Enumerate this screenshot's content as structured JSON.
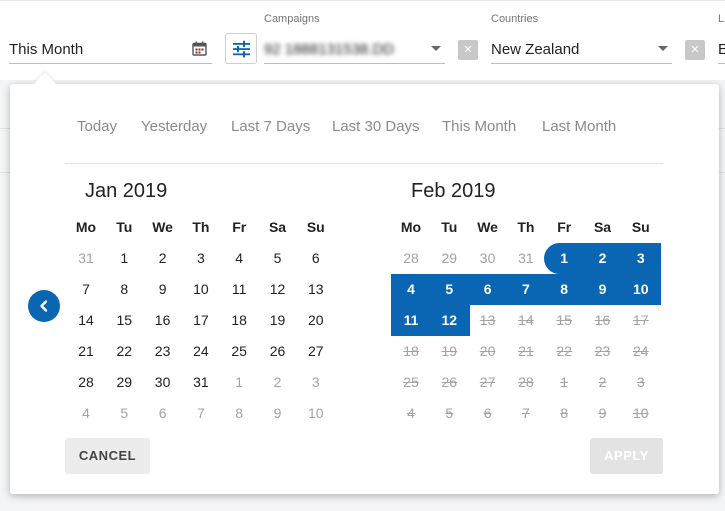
{
  "topbar": {
    "date_range_value": "This Month",
    "campaigns_label": "Campaigns",
    "campaigns_value": "92 1888131538.DD",
    "countries_label": "Countries",
    "countries_value": "New Zealand",
    "third_label": "L",
    "third_value": "E"
  },
  "presets": [
    "Today",
    "Yesterday",
    "Last 7 Days",
    "Last 30 Days",
    "This Month",
    "Last Month"
  ],
  "weekdays": [
    "Mo",
    "Tu",
    "We",
    "Th",
    "Fr",
    "Sa",
    "Su"
  ],
  "calendars": [
    {
      "title": "Jan 2019",
      "rows": [
        [
          {
            "d": "31",
            "s": "muted"
          },
          {
            "d": "1"
          },
          {
            "d": "2"
          },
          {
            "d": "3"
          },
          {
            "d": "4"
          },
          {
            "d": "5"
          },
          {
            "d": "6"
          }
        ],
        [
          {
            "d": "7"
          },
          {
            "d": "8"
          },
          {
            "d": "9"
          },
          {
            "d": "10"
          },
          {
            "d": "11"
          },
          {
            "d": "12"
          },
          {
            "d": "13"
          }
        ],
        [
          {
            "d": "14"
          },
          {
            "d": "15"
          },
          {
            "d": "16"
          },
          {
            "d": "17"
          },
          {
            "d": "18"
          },
          {
            "d": "19"
          },
          {
            "d": "20"
          }
        ],
        [
          {
            "d": "21"
          },
          {
            "d": "22"
          },
          {
            "d": "23"
          },
          {
            "d": "24"
          },
          {
            "d": "25"
          },
          {
            "d": "26"
          },
          {
            "d": "27"
          }
        ],
        [
          {
            "d": "28"
          },
          {
            "d": "29"
          },
          {
            "d": "30"
          },
          {
            "d": "31"
          },
          {
            "d": "1",
            "s": "muted"
          },
          {
            "d": "2",
            "s": "muted"
          },
          {
            "d": "3",
            "s": "muted"
          }
        ],
        [
          {
            "d": "4",
            "s": "muted"
          },
          {
            "d": "5",
            "s": "muted"
          },
          {
            "d": "6",
            "s": "muted"
          },
          {
            "d": "7",
            "s": "muted"
          },
          {
            "d": "8",
            "s": "muted"
          },
          {
            "d": "9",
            "s": "muted"
          },
          {
            "d": "10",
            "s": "muted"
          }
        ]
      ]
    },
    {
      "title": "Feb 2019",
      "rows": [
        [
          {
            "d": "28",
            "s": "muted"
          },
          {
            "d": "29",
            "s": "muted"
          },
          {
            "d": "30",
            "s": "muted"
          },
          {
            "d": "31",
            "s": "muted"
          },
          {
            "d": "1",
            "s": "sel"
          },
          {
            "d": "2",
            "s": "sel"
          },
          {
            "d": "3",
            "s": "sel"
          }
        ],
        [
          {
            "d": "4",
            "s": "sel"
          },
          {
            "d": "5",
            "s": "sel"
          },
          {
            "d": "6",
            "s": "sel"
          },
          {
            "d": "7",
            "s": "sel"
          },
          {
            "d": "8",
            "s": "sel"
          },
          {
            "d": "9",
            "s": "sel"
          },
          {
            "d": "10",
            "s": "sel"
          }
        ],
        [
          {
            "d": "11",
            "s": "sel"
          },
          {
            "d": "12",
            "s": "sel"
          },
          {
            "d": "13",
            "s": "strike"
          },
          {
            "d": "14",
            "s": "strike"
          },
          {
            "d": "15",
            "s": "strike"
          },
          {
            "d": "16",
            "s": "strike"
          },
          {
            "d": "17",
            "s": "strike"
          }
        ],
        [
          {
            "d": "18",
            "s": "strike"
          },
          {
            "d": "19",
            "s": "strike"
          },
          {
            "d": "20",
            "s": "strike"
          },
          {
            "d": "21",
            "s": "strike"
          },
          {
            "d": "22",
            "s": "strike"
          },
          {
            "d": "23",
            "s": "strike"
          },
          {
            "d": "24",
            "s": "strike"
          }
        ],
        [
          {
            "d": "25",
            "s": "strike"
          },
          {
            "d": "26",
            "s": "strike"
          },
          {
            "d": "27",
            "s": "strike"
          },
          {
            "d": "28",
            "s": "strike"
          },
          {
            "d": "1",
            "s": "strike"
          },
          {
            "d": "2",
            "s": "strike"
          },
          {
            "d": "3",
            "s": "strike"
          }
        ],
        [
          {
            "d": "4",
            "s": "strike"
          },
          {
            "d": "5",
            "s": "strike"
          },
          {
            "d": "6",
            "s": "strike"
          },
          {
            "d": "7",
            "s": "strike"
          },
          {
            "d": "8",
            "s": "strike"
          },
          {
            "d": "9",
            "s": "strike"
          },
          {
            "d": "10",
            "s": "strike"
          }
        ]
      ]
    }
  ],
  "actions": {
    "cancel_label": "CANCEL",
    "apply_label": "APPLY"
  },
  "colors": {
    "accent": "#0a66b3",
    "muted_text": "#a3a3a3",
    "apply_disabled_bg": "#e3e3e3"
  },
  "icons": {
    "date_field": "calendar-icon",
    "filter": "sliders-icon",
    "prev": "chevron-left-icon",
    "clear": "close-icon"
  }
}
